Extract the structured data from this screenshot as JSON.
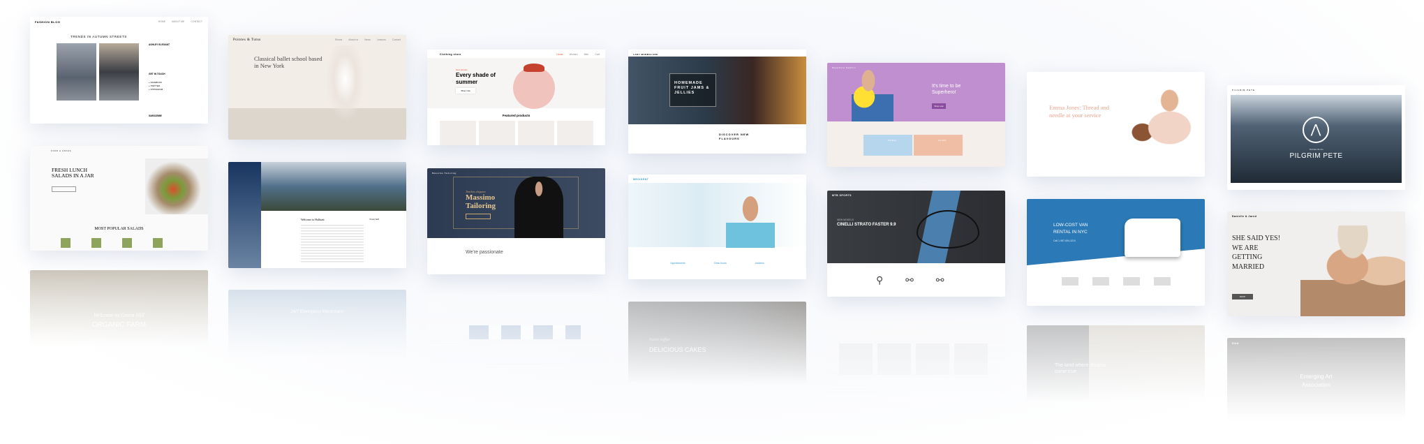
{
  "fashion": {
    "logo": "FASHION BLOG",
    "nav": [
      "HOME",
      "ABOUT ME",
      "CONTACT"
    ],
    "title": "TRENDS IN AUTUMN STREETS",
    "author": "ASHLEY ELEGANT",
    "touch": "GET IN TOUCH",
    "links": [
      "+ FACEBOOK",
      "+ TWITTER",
      "+ INSTAGRAM"
    ],
    "subscribe": "SUBSCRIBE"
  },
  "salads": {
    "logo": "FOOD & GRASS",
    "title": "FRESH LUNCH SALADS IN A JAR",
    "section": "MOST POPULAR SALADS"
  },
  "farm": {
    "script": "Welcome to Green Hill",
    "title": "ORGANIC FARM"
  },
  "ballet": {
    "logo": "Pointes & Tutus",
    "nav": [
      "Shows",
      "About us",
      "News",
      "Lessons",
      "Contact"
    ],
    "title": "Classical ballet school based in New York"
  },
  "hallstatt": {
    "title": "Welcome to Hallstatt",
    "side": "Town hall"
  },
  "electric": {
    "title": "24/7 Emergency Electricians"
  },
  "clothing": {
    "logo": "Clothing store",
    "nav": [
      "Home",
      "Women",
      "Men",
      "Cart"
    ],
    "kicker": "New arrivals",
    "title": "Every shade of summer",
    "button": "Shop now",
    "section": "Featured products"
  },
  "massimo": {
    "logo": "Massimo Tailoring",
    "kicker": "Timeless elegance",
    "title": "Massimo Tailoring",
    "sub": "We're passionate"
  },
  "marmalade": {
    "logo": "LADY MARMALADE",
    "title": "HOMEMADE FRUIT JAMS & JELLIES",
    "sub": "DISCOVER NEW FLAVOURS"
  },
  "medident": {
    "logo": "MEDIDENT",
    "info": [
      "Appointments",
      "Clinic hours",
      "Address"
    ]
  },
  "cakes": {
    "script": "Sweet coffee",
    "title": "DELICIOUS CAKES"
  },
  "superhero": {
    "logo": "Superhero Fashion",
    "title": "It's time to be Superhero!",
    "button": "Shop now",
    "boys": "For Boys",
    "girls": "For Girls"
  },
  "mtb": {
    "logo": "MTB SPORTS",
    "kicker": "NEW MODELS",
    "title": "CINELLI STRATO FASTER 9.9"
  },
  "emma": {
    "title": "Emma Jones: Thread and needle at your service"
  },
  "van": {
    "title": "LOW-COST VAN RENTAL IN NYC",
    "phone": "Call 1-987-654-3210"
  },
  "land": {
    "title": "The land where dreams come true"
  },
  "pilgrim": {
    "logo": "PILGRIM PETE",
    "kicker": "TRAVEL BLOG",
    "title": "PILGRIM PETE"
  },
  "wedding": {
    "logo": "Danielle & Jared",
    "title": "SHE SAID YES! WE ARE GETTING MARRIED",
    "button": "RSVP"
  },
  "eaa": {
    "logo": "EAA",
    "title": "Emerging Art Association"
  }
}
